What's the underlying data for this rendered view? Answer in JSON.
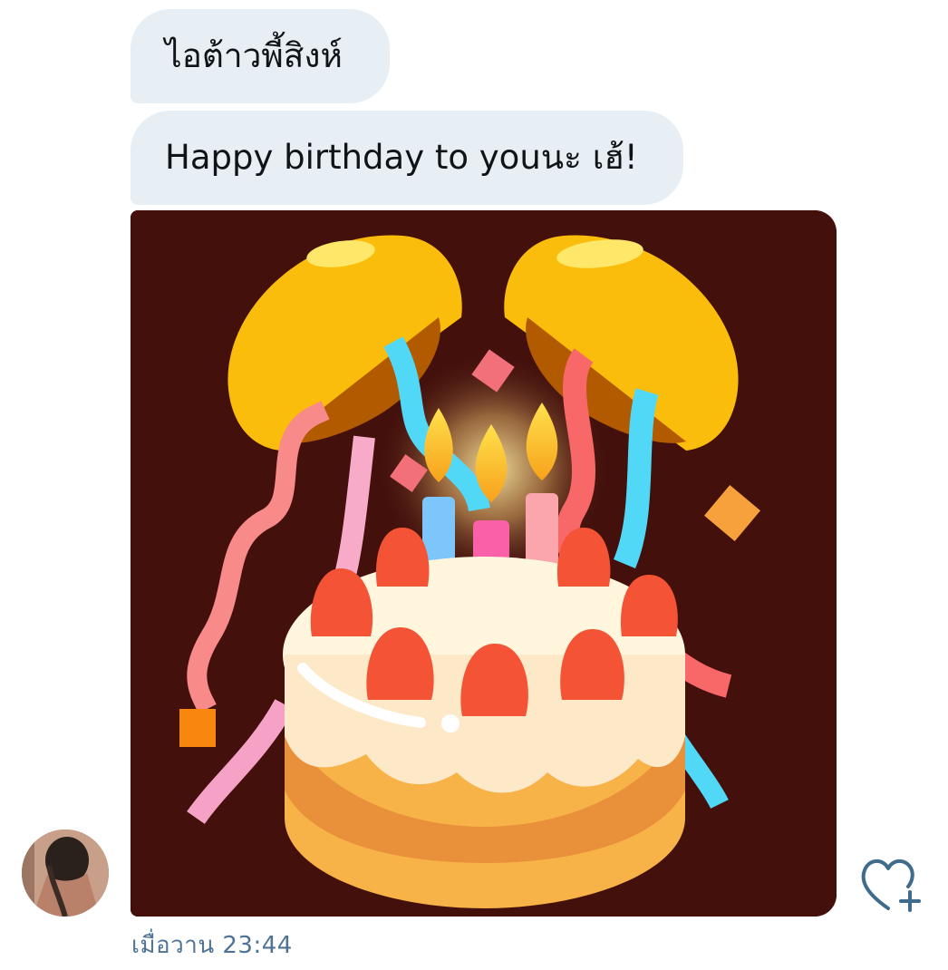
{
  "conversation": {
    "messages": [
      {
        "text": "ไอต้าวพี้สิงห์"
      },
      {
        "text": "Happy birthday to youนะ เฮ้!"
      }
    ],
    "media": {
      "icon": "birthday-cake-confetti-sticker"
    },
    "timestamp": "เมื่อวาน 23:44",
    "avatar": {
      "icon": "user-avatar-photo"
    },
    "reaction_button": {
      "icon": "heart-plus-icon",
      "color": "#3f6b8c"
    }
  },
  "colors": {
    "bubble_bg": "#e7eef4",
    "media_bg": "#43100c",
    "timestamp": "#4e7394",
    "text": "#0f1419"
  }
}
